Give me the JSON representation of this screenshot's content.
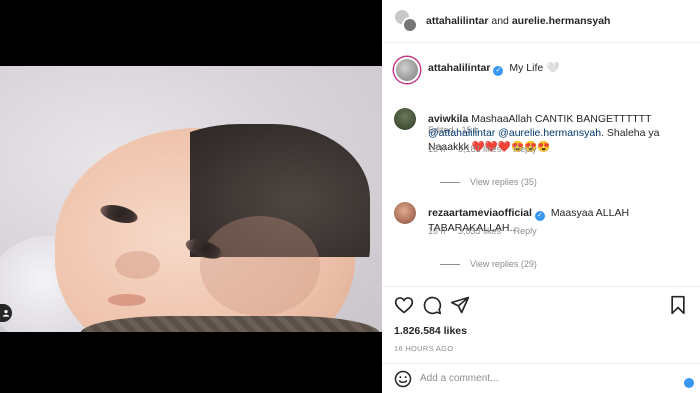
{
  "header": {
    "user1": "attahalilintar",
    "and_text": "and",
    "user2": "aurelie.hermansyah"
  },
  "caption": {
    "username": "attahalilintar",
    "text": "My Life 🤍",
    "edited": "Edited · 15 h"
  },
  "comments": [
    {
      "username": "aviwkila",
      "text_before": "MashaaAllah CANTIK BANGETTTTTT ",
      "mention1": "@attahalilintar",
      "mention2": "@aurelie.hermansyah",
      "text_after": ". Shaleha ya Naaakkk ❤️❤️❤️😍😍😍",
      "time": "16 h",
      "likes": "3,181 likes",
      "reply": "Reply",
      "view_replies": "View replies (35)"
    },
    {
      "username": "rezaartameviaofficial",
      "text": "Maasyaa ALLAH TABARAKALLAH..",
      "time": "16 h",
      "likes": "3,835 likes",
      "reply": "Reply",
      "view_replies": "View replies (29)"
    }
  ],
  "post": {
    "likes": "1.826.584 likes",
    "time": "16 HOURS AGO",
    "add_comment_placeholder": "Add a comment..."
  },
  "icons": [
    "heart-icon",
    "comment-icon",
    "share-icon",
    "bookmark-icon",
    "smile-icon",
    "user-icon"
  ],
  "colors": {
    "verified": "#3897f0",
    "mention": "#00376b",
    "muted": "#8e8e8e"
  }
}
